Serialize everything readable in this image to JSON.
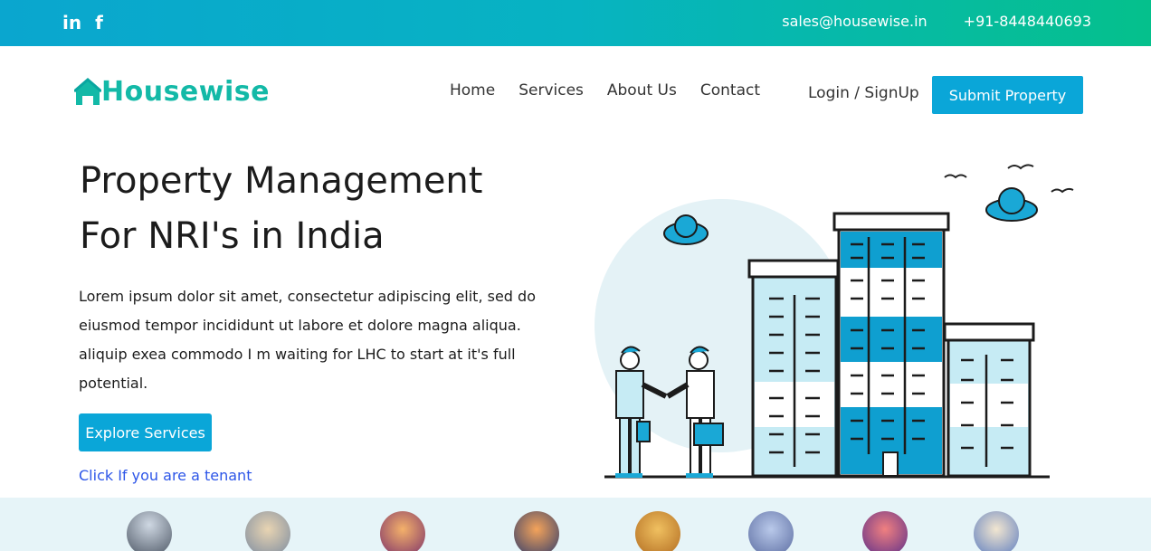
{
  "topbar": {
    "social": [
      {
        "icon": "linkedin-icon",
        "glyph": "in"
      },
      {
        "icon": "facebook-icon",
        "glyph": "f"
      }
    ],
    "email": "sales@housewise.in",
    "phone": "+91-8448440693"
  },
  "nav": {
    "brand": "Housewise",
    "links": [
      "Home",
      "Services",
      "About Us",
      "Contact"
    ],
    "login": "Login / SignUp",
    "submit": "Submit Property"
  },
  "hero": {
    "title_line1": "Property Management",
    "title_line2": "For NRI's in India",
    "text": "Lorem ipsum dolor sit amet, consectetur adipiscing elit, sed do eiusmod tempor incididunt ut labore et dolore magna aliqua. aliquip exea commodo I m waiting for LHC to start at it's full potential.",
    "explore": "Explore Services",
    "tenant_link": "Click If you are a tenant"
  },
  "colors": {
    "accent": "#0aa6d8",
    "brand": "#13b9a7",
    "link": "#2c55e8"
  }
}
